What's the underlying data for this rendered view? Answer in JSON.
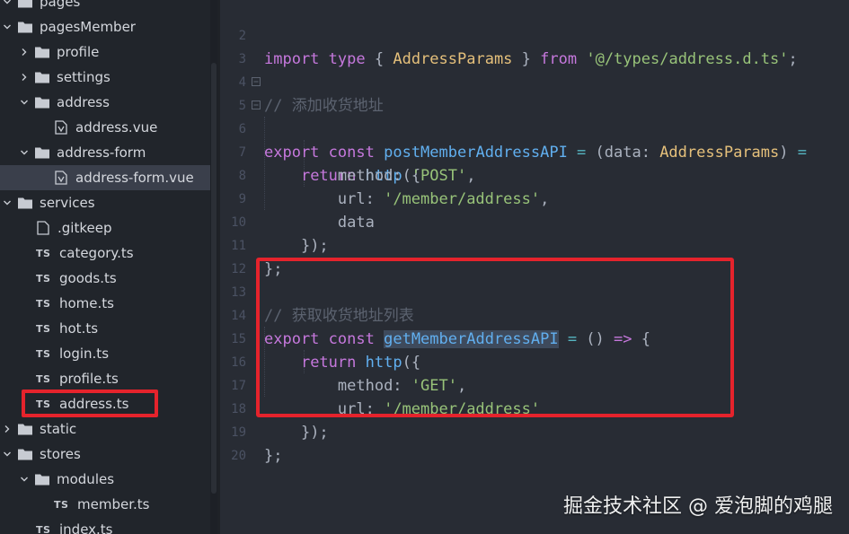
{
  "explorer": {
    "items": [
      {
        "label": "pages",
        "kind": "folder",
        "expanded": true
      },
      {
        "label": "pagesMember",
        "kind": "folder",
        "expanded": true
      },
      {
        "label": "profile",
        "kind": "folder",
        "expanded": false
      },
      {
        "label": "settings",
        "kind": "folder",
        "expanded": false
      },
      {
        "label": "address",
        "kind": "folder",
        "expanded": true
      },
      {
        "label": "address.vue",
        "kind": "vue"
      },
      {
        "label": "address-form",
        "kind": "folder",
        "expanded": true
      },
      {
        "label": "address-form.vue",
        "kind": "vue",
        "selected": true
      },
      {
        "label": "services",
        "kind": "folder",
        "expanded": true
      },
      {
        "label": ".gitkeep",
        "kind": "file"
      },
      {
        "label": "category.ts",
        "kind": "ts"
      },
      {
        "label": "goods.ts",
        "kind": "ts"
      },
      {
        "label": "home.ts",
        "kind": "ts"
      },
      {
        "label": "hot.ts",
        "kind": "ts"
      },
      {
        "label": "login.ts",
        "kind": "ts"
      },
      {
        "label": "profile.ts",
        "kind": "ts"
      },
      {
        "label": "address.ts",
        "kind": "ts",
        "highlighted": true
      },
      {
        "label": "static",
        "kind": "folder",
        "expanded": false
      },
      {
        "label": "stores",
        "kind": "folder",
        "expanded": true
      },
      {
        "label": "modules",
        "kind": "folder",
        "expanded": true
      },
      {
        "label": "member.ts",
        "kind": "ts"
      },
      {
        "label": "index.ts",
        "kind": "ts"
      }
    ],
    "ts_badge": "TS"
  },
  "editor": {
    "line_numbers": [
      "2",
      "3",
      "4",
      "5",
      "6",
      "7",
      "8",
      "9",
      "10",
      "11",
      "12",
      "13",
      "14",
      "15",
      "16",
      "17",
      "18",
      "19",
      "20"
    ],
    "code": {
      "l2": {
        "kw1": "import",
        "kw2": "type",
        "p1": "{ ",
        "ty": "AddressParams",
        "p2": " } ",
        "kw3": "from",
        "str": "'@/types/address.d.ts'",
        "p3": ";"
      },
      "l4": {
        "cm": "// 添加收货地址"
      },
      "l5": {
        "kw1": "export",
        "kw2": "const",
        "fn": "postMemberAddressAPI",
        "op1": " = ",
        "p1": "(data: ",
        "ty": "AddressParams",
        "p2": ") ",
        "op2": "="
      },
      "l6": {
        "kw": "return",
        "fn": "http",
        "p": "({"
      },
      "l7": {
        "prop": "method: ",
        "str": "'POST'",
        "p": ","
      },
      "l8": {
        "prop": "url: ",
        "str": "'/member/address'",
        "p": ","
      },
      "l9": {
        "prop": "data"
      },
      "l10": {
        "p": "});"
      },
      "l11": {
        "p": "};"
      },
      "l13": {
        "cm": "// 获取收货地址列表"
      },
      "l14": {
        "kw1": "export",
        "kw2": "const",
        "fn": "getMemberAddressAPI",
        "op1": " = ",
        "p1": "() ",
        "op2": "=>",
        "p2": " {"
      },
      "l15": {
        "kw": "return",
        "fn": "http",
        "p": "({"
      },
      "l16": {
        "prop": "method: ",
        "str": "'GET'",
        "p": ","
      },
      "l17": {
        "prop": "url: ",
        "str": "'/member/address'"
      },
      "l18": {
        "p": "});"
      },
      "l19": {
        "p": "};"
      }
    }
  },
  "watermark": "掘金技术社区 @ 爱泡脚的鸡腿",
  "colors": {
    "annotation_red": "#e5232c",
    "keyword": "#c678dd",
    "function": "#61afef",
    "type": "#e5c07b",
    "string": "#98c379",
    "comment": "#5c6370"
  }
}
